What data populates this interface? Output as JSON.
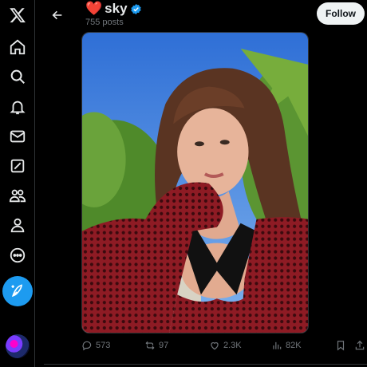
{
  "nav": {
    "items": [
      {
        "name": "x-logo-icon"
      },
      {
        "name": "home-icon"
      },
      {
        "name": "search-icon"
      },
      {
        "name": "notifications-icon"
      },
      {
        "name": "messages-icon"
      },
      {
        "name": "grok-icon"
      },
      {
        "name": "communities-icon"
      },
      {
        "name": "profile-icon"
      },
      {
        "name": "more-icon"
      }
    ],
    "compose_icon": "compose-feather-icon"
  },
  "header": {
    "emoji": "❤️",
    "display_name": "sky",
    "verified": true,
    "post_count": "755 posts",
    "follow_label": "Follow"
  },
  "media": {
    "description_icon": "photo"
  },
  "actions": {
    "replies": "573",
    "reposts": "97",
    "likes": "2.3K",
    "views": "82K"
  },
  "colors": {
    "accent": "#1d9bf0",
    "background": "#000000",
    "text": "#e7e9ea",
    "muted": "#71767b",
    "heart": "#e0245e"
  }
}
